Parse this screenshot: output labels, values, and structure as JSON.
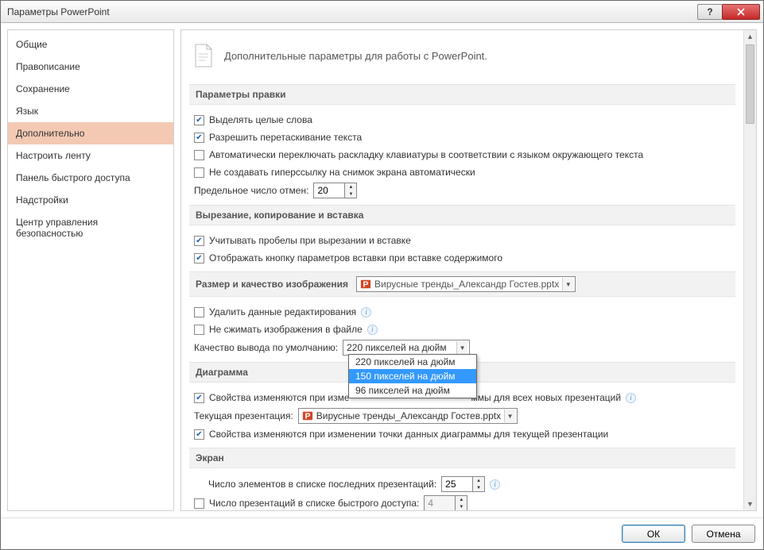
{
  "window": {
    "title": "Параметры PowerPoint"
  },
  "sidebar": {
    "items": [
      "Общие",
      "Правописание",
      "Сохранение",
      "Язык",
      "Дополнительно",
      "Настроить ленту",
      "Панель быстрого доступа",
      "Надстройки",
      "Центр управления безопасностью"
    ],
    "selected_index": 4
  },
  "main": {
    "heading": "Дополнительные параметры для работы с PowerPoint.",
    "sections": {
      "edit": {
        "title": "Параметры правки",
        "opt_select_words": "Выделять целые слова",
        "opt_drag_drop": "Разрешить перетаскивание текста",
        "opt_auto_kbd": "Автоматически переключать раскладку клавиатуры в соответствии с языком окружающего текста",
        "opt_no_hyperlink": "Не создавать гиперссылку на снимок экрана автоматически",
        "undo_label": "Предельное число отмен:",
        "undo_value": "20"
      },
      "clipboard": {
        "title": "Вырезание, копирование и вставка",
        "opt_spaces": "Учитывать пробелы при вырезании и вставке",
        "opt_paste_btn": "Отображать кнопку параметров вставки при вставке содержимого"
      },
      "image": {
        "title": "Размер и качество изображения",
        "file": "Вирусные тренды_Александр Гостев.pptx",
        "opt_discard": "Удалить данные редактирования",
        "opt_nocompress": "Не сжимать изображения в файле",
        "quality_label": "Качество вывода по умолчанию:",
        "quality_value": "220 пикселей на дюйм",
        "quality_options": [
          "220 пикселей на дюйм",
          "150 пикселей на дюйм",
          "96 пикселей на дюйм"
        ],
        "quality_highlight_index": 1
      },
      "chart": {
        "title": "Диаграмма",
        "opt_all_new": "Свойства изменяются при изме",
        "opt_all_new_tail": "ммы для всех новых презентаций",
        "current_label": "Текущая презентация:",
        "current_file": "Вирусные тренды_Александр Гостев.pptx",
        "opt_current": "Свойства изменяются при изменении точки данных диаграммы для текущей презентации"
      },
      "screen": {
        "title": "Экран",
        "recent_label": "Число элементов в списке последних презентаций:",
        "recent_value": "25",
        "quick_label": "Число презентаций в списке быстрого доступа:",
        "quick_value": "4"
      }
    }
  },
  "footer": {
    "ok": "ОК",
    "cancel": "Отмена"
  }
}
